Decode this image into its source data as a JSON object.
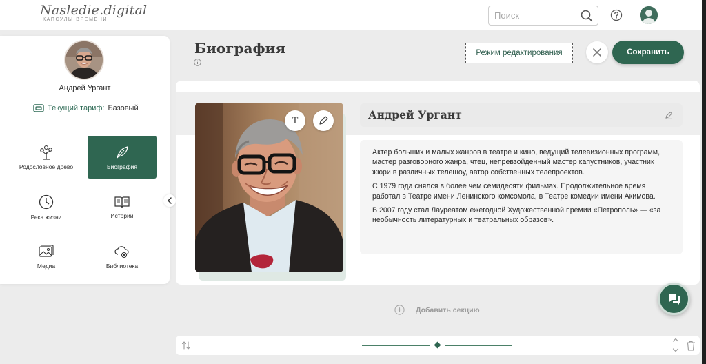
{
  "header": {
    "logo_title": "Nasledie.digital",
    "logo_subtitle": "КАПСУЛЫ ВРЕМЕНИ",
    "search_placeholder": "Поиск",
    "icons": [
      "search-icon",
      "help-icon",
      "user-avatar"
    ]
  },
  "sidebar": {
    "profile_name": "Андрей Ургант",
    "tariff_label": "Текущий тариф:",
    "tariff_value": "Базовый",
    "menu": [
      {
        "label": "Родословное древо",
        "icon": "tree-icon",
        "active": false
      },
      {
        "label": "Биография",
        "icon": "feather-icon",
        "active": true
      },
      {
        "label": "Река жизни",
        "icon": "clock-icon",
        "active": false
      },
      {
        "label": "Истории",
        "icon": "book-icon",
        "active": false
      },
      {
        "label": "Медиа",
        "icon": "media-icon",
        "active": false
      },
      {
        "label": "Библиотека",
        "icon": "cloud-library-icon",
        "active": false
      }
    ]
  },
  "main": {
    "title": "Биография",
    "edit_mode_label": "Режим редактирования",
    "save_label": "Сохранить",
    "photo_tools": {
      "text_tool": "T"
    },
    "person_name": "Андрей Ургант",
    "bio_paragraphs": [
      "Актер больших и малых жанров в театре и кино, ведущий телевизионных программ, мастер разговорного жанра, чтец, непревзойденный мастер капустников, участник жюри в различных телешоу, автор собственных телепроектов.",
      "С 1979 года снялся в более чем семидесяти фильмах. Продолжительное время работал в Театре имени Ленинского комсомола, в Театре комедии имени Акимова.",
      "В 2007 году стал Лауреатом ежегодной Художественной премии «Петрополь» — «за необычность литературных и театральных образов»."
    ],
    "add_section_label": "Добавить секцию"
  },
  "colors": {
    "accent": "#2f6651",
    "accent_text": "#2f6b56",
    "background": "#ececec"
  }
}
